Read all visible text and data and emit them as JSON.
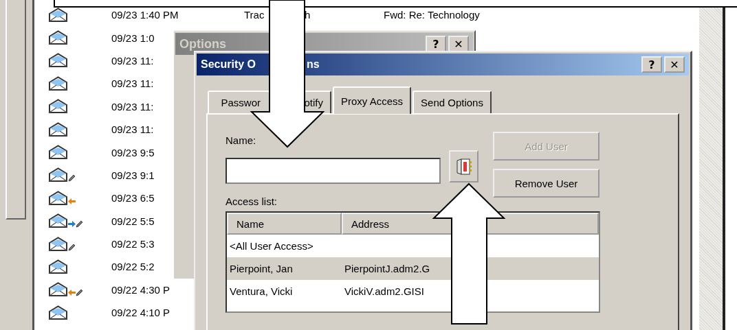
{
  "messages": [
    {
      "kind": "plain",
      "date": "09/23 1:40 PM",
      "sender_parts": [
        "Trac",
        "h"
      ],
      "subject": "Fwd: Re: Technology"
    },
    {
      "kind": "plain",
      "date": "09/23 1:0"
    },
    {
      "kind": "plain",
      "date": "09/23 11:"
    },
    {
      "kind": "plain",
      "date": "09/23 11:"
    },
    {
      "kind": "plain",
      "date": "09/23 11:"
    },
    {
      "kind": "plain",
      "date": "09/23 11:"
    },
    {
      "kind": "plain",
      "date": "09/23 9:5"
    },
    {
      "kind": "edited",
      "date": "09/23 9:1"
    },
    {
      "kind": "replied",
      "date": "09/23 6:5"
    },
    {
      "kind": "forwarded_edited",
      "date": "09/22 5:5"
    },
    {
      "kind": "edited",
      "date": "09/22 5:3"
    },
    {
      "kind": "plain",
      "date": "09/22 5:2"
    },
    {
      "kind": "replied_edited",
      "date": "09/22 4:30 P"
    },
    {
      "kind": "plain",
      "date": "09/22 4:10 P"
    }
  ],
  "options_window": {
    "title": "Options",
    "active": false,
    "title_buttons": [
      "?",
      "✕"
    ]
  },
  "security_dialog": {
    "title_parts": [
      "Security O",
      "ns"
    ],
    "active": true,
    "title_buttons": [
      "?",
      "✕"
    ],
    "tabs": [
      {
        "label_parts": [
          "Passwor",
          "otify"
        ],
        "selected": false
      },
      {
        "label_parts": [
          "Proxy Access"
        ],
        "selected": true
      },
      {
        "label_parts": [
          "Send Options"
        ],
        "selected": false
      }
    ],
    "name_label": "Name:",
    "buttons": [
      {
        "label": "Add User",
        "disabled": true
      },
      {
        "label": "Remove User",
        "disabled": false
      }
    ],
    "access_label": "Access list:",
    "columns": [
      "Name",
      "Address"
    ],
    "rows": [
      {
        "name": "<All User Access>",
        "selected": false
      },
      {
        "name": "Pierpoint, Jan",
        "address": "PierpointJ.adm2.G",
        "selected": true
      },
      {
        "name": "Ventura, Vicki",
        "address": "VickiV.adm2.GISI",
        "selected": false
      }
    ]
  }
}
